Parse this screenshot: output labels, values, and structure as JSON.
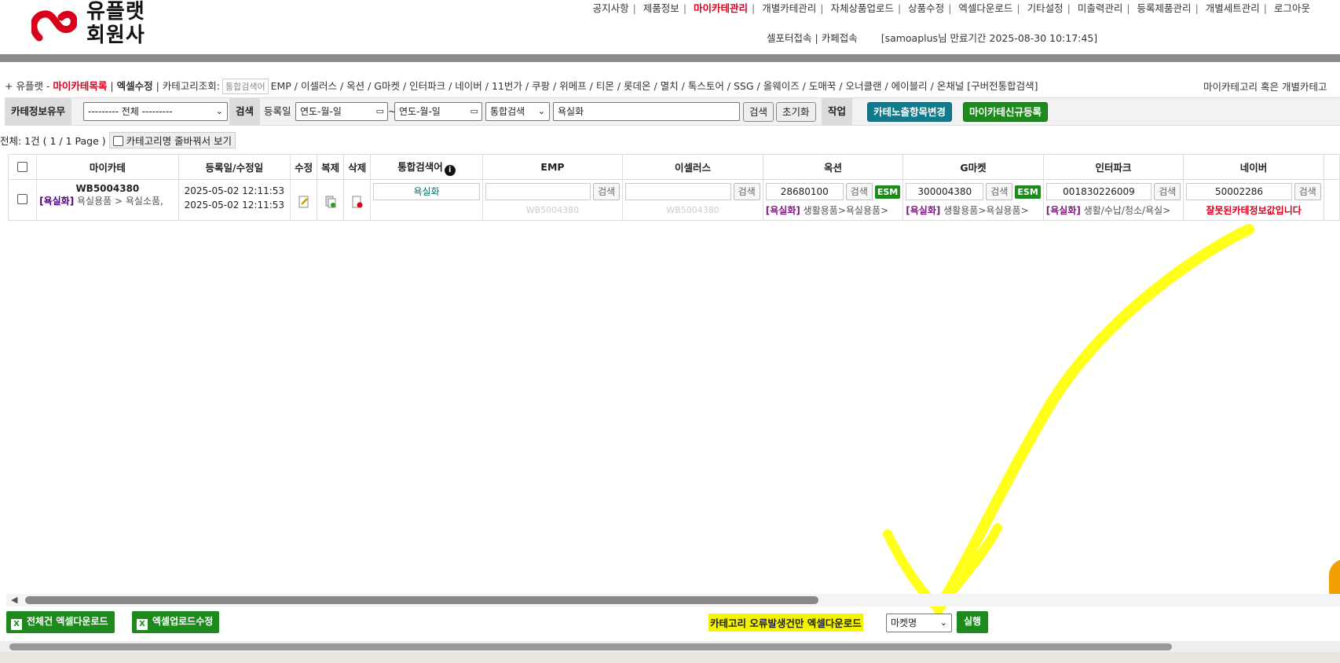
{
  "logo": {
    "line1": "유플랫",
    "line2": "회원사",
    "brand_color": "#d9001b"
  },
  "topnav": {
    "items": [
      "공지사항",
      "제품정보",
      "마이카테관리",
      "개별카테관리",
      "자체상품업로드",
      "상품수정",
      "엑셀다운로드",
      "기타설정",
      "미출력관리",
      "등록제품관리",
      "개별세트관리",
      "로그아웃"
    ],
    "active": "마이카테관리"
  },
  "subnav": {
    "link1": "셀포터접속",
    "link2": "카페접속",
    "user_info": "[samoaplus님 만료기간 2025-08-30 10:17:45]"
  },
  "catline": {
    "prefix": "+ 유플랫 - ",
    "mycat": "마이카테목록",
    "excel_edit": "엑셀수정",
    "cat_search": "카테고리조회:",
    "placeholder": "통합검색어",
    "markets": "EMP / 이셀러스 / 옥션 / G마켓 / 인터파크 / 네이버 / 11번가 / 쿠팡 / 위메프 / 티몬 / 롯데온 / 멸치 / 톡스토어 / SSG / 올웨이즈 / 도매꾹 / 오너클랜 / 에이블리 / 온채널 [구버전통합검색]",
    "right": "마이카테고리 혹은 개별카테고"
  },
  "filter": {
    "info_label": "카테정보유무",
    "info_select": "--------- 전체 ---------",
    "search_label": "검색",
    "date_label": "등록일",
    "date_from": "연도-월-일",
    "date_to": "연도-월-일",
    "tilde": "~",
    "type_select": "통합검색",
    "keyword": "욕실화",
    "search_btn": "검색",
    "reset_btn": "초기화",
    "action_label": "작업",
    "change_btn": "카테노출항목변경",
    "new_btn": "마이카테신규등록"
  },
  "summary": {
    "total": "전체: 1건 ( 1 / 1 Page )",
    "toggle": "카테고리명 줄바꿔서 보기"
  },
  "table": {
    "headers": [
      "마이카테",
      "등록일/수정일",
      "수정",
      "복제",
      "삭제",
      "통합검색어",
      "EMP",
      "이셀러스",
      "옥션",
      "G마켓",
      "인터파크",
      "네이버"
    ],
    "row": {
      "code": "WB5004380",
      "tag": "[욕실화]",
      "category": "욕실용품 > 욕실소품,",
      "reg_date": "2025-05-02 12:11:53",
      "mod_date": "2025-05-02 12:11:53",
      "keyword": "욕실화",
      "emp_ghost": "WB5004380",
      "esellers_ghost": "WB5004380",
      "search_btn": "검색",
      "esm": "ESM",
      "auction_code": "28680100",
      "auction_cat": "생활용품>욕실용품>",
      "gmarket_code": "300004380",
      "gmarket_cat": "생활용품>욕실용품>",
      "interpark_code": "001830226009",
      "interpark_cat": "생활/수납/청소/욕실>",
      "naver_code": "50002286",
      "naver_err": "잘못된카테정보값입니다",
      "tag_short": "[욕실화]"
    }
  },
  "bottom": {
    "dl_all": "전체건 엑셀다운로드",
    "upload_edit": "엑셀업로드수정",
    "err_label": "카테고리 오류발생건만 엑셀다운로드",
    "market_select": "마켓명",
    "run_btn": "실행"
  },
  "colors": {
    "accent": "#d9001b",
    "green": "#1e8a1e",
    "teal": "#117a8b",
    "highlight": "#f4f400"
  }
}
